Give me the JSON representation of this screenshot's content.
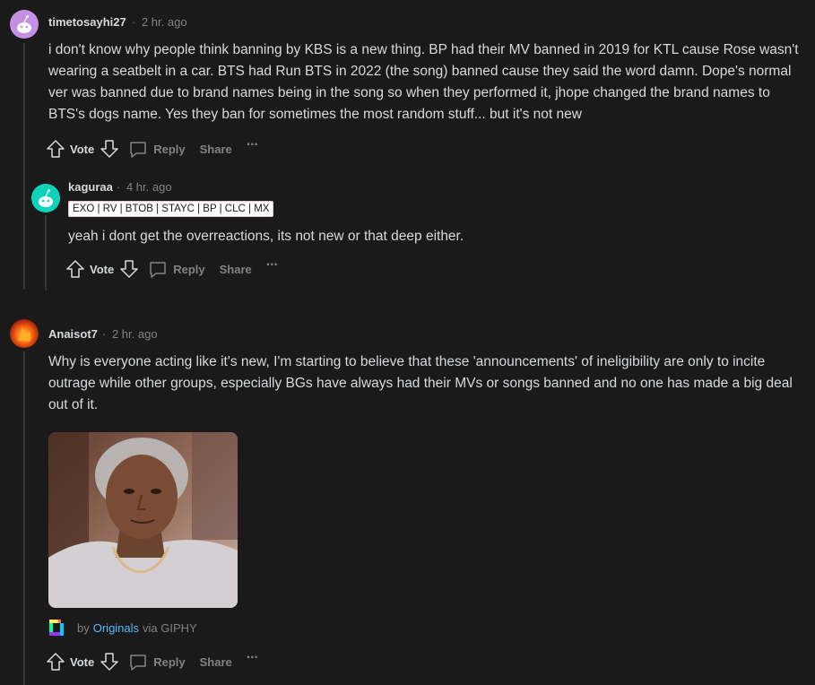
{
  "comments": [
    {
      "username": "timetosayhi27",
      "time": "2 hr. ago",
      "body": "i don't know why people think banning by KBS is a new thing. BP had their MV banned in 2019 for KTL cause Rose wasn't wearing a seatbelt in a car. BTS had Run BTS in 2022 (the song) banned cause they said the word damn. Dope's normal ver was banned due to brand names being in the song so when they performed it, jhope changed the brand names to BTS's dogs name. Yes they ban for sometimes the most random stuff... but it's not new",
      "actions": {
        "vote": "Vote",
        "reply": "Reply",
        "share": "Share",
        "more": "···"
      }
    },
    {
      "username": "kaguraa",
      "time": "4 hr. ago",
      "flair": "EXO | RV | BTOB | STAYC | BP | CLC | MX",
      "body": "yeah i dont get the overreactions, its not new or that deep either.",
      "actions": {
        "vote": "Vote",
        "reply": "Reply",
        "share": "Share",
        "more": "···"
      }
    },
    {
      "username": "Anaisot7",
      "time": "2 hr. ago",
      "body": "Why is everyone acting like it's new, I'm starting to believe that these 'announcements' of ineligibility are only to incite outrage while other groups, especially BGs have always had their MVs or songs banned and no one has made a big deal out of it.",
      "gif_attribution": {
        "by": "by",
        "source": "Originals",
        "via": "via GIPHY"
      },
      "actions": {
        "vote": "Vote",
        "reply": "Reply",
        "share": "Share",
        "more": "···"
      }
    }
  ],
  "separator": "·",
  "colors": {
    "background": "#1a1a1b",
    "text": "#d7dadc",
    "muted": "#818384",
    "link": "#4fbcff",
    "thread": "#343536"
  }
}
